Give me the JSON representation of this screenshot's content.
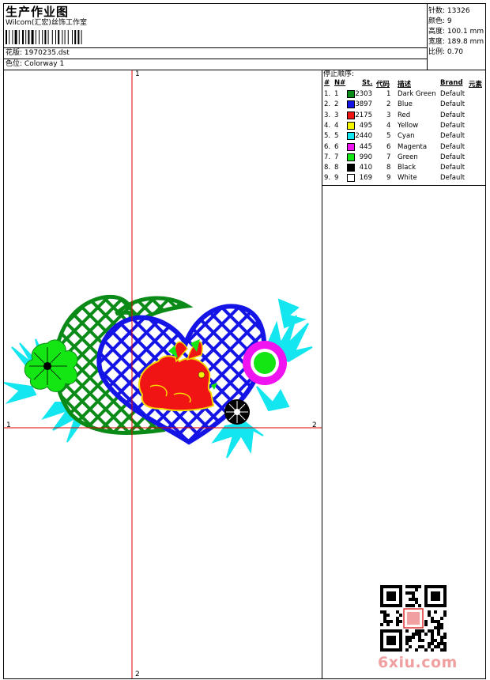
{
  "header": {
    "title": "生产作业图",
    "company": "Wilcom(汇宏)丝饰工作室",
    "design_file_label": "花版:",
    "design_file": "1970235.dst",
    "colorway_label": "色位:",
    "colorway": "Colorway 1"
  },
  "stats": [
    {
      "label": "针数:",
      "value": "13326"
    },
    {
      "label": "颜色:",
      "value": "9"
    },
    {
      "label": "高度:",
      "value": "100.1 mm"
    },
    {
      "label": "宽度:",
      "value": "189.8 mm"
    },
    {
      "label": "比例:",
      "value": "0.70"
    }
  ],
  "stop_sequence": {
    "heading": "停止顺序:",
    "columns": [
      "#",
      "N#",
      "St.",
      "代码",
      "描述",
      "Brand",
      "元素"
    ],
    "rows": [
      {
        "n": "1.",
        "nn": "1",
        "st": "2303",
        "code": "1",
        "desc": "Dark Green",
        "brand": "Default",
        "color": "#0a8a16"
      },
      {
        "n": "2.",
        "nn": "2",
        "st": "3897",
        "code": "2",
        "desc": "Blue",
        "brand": "Default",
        "color": "#1414e6"
      },
      {
        "n": "3.",
        "nn": "3",
        "st": "2175",
        "code": "3",
        "desc": "Red",
        "brand": "Default",
        "color": "#f01414"
      },
      {
        "n": "4.",
        "nn": "4",
        "st": "495",
        "code": "4",
        "desc": "Yellow",
        "brand": "Default",
        "color": "#f5f500"
      },
      {
        "n": "5.",
        "nn": "5",
        "st": "2440",
        "code": "5",
        "desc": "Cyan",
        "brand": "Default",
        "color": "#14e6f0"
      },
      {
        "n": "6.",
        "nn": "6",
        "st": "445",
        "code": "6",
        "desc": "Magenta",
        "brand": "Default",
        "color": "#f014f0"
      },
      {
        "n": "7.",
        "nn": "7",
        "st": "990",
        "code": "7",
        "desc": "Green",
        "brand": "Default",
        "color": "#14e614"
      },
      {
        "n": "8.",
        "nn": "8",
        "st": "410",
        "code": "8",
        "desc": "Black",
        "brand": "Default",
        "color": "#000000"
      },
      {
        "n": "9.",
        "nn": "9",
        "st": "169",
        "code": "9",
        "desc": "White",
        "brand": "Default",
        "color": "#ffffff"
      }
    ]
  },
  "axis_labels": {
    "top": "1",
    "bottom": "2",
    "left": "1",
    "right": "2"
  },
  "watermark": "6xiu.com",
  "colors": {
    "axis": "#e00000"
  }
}
